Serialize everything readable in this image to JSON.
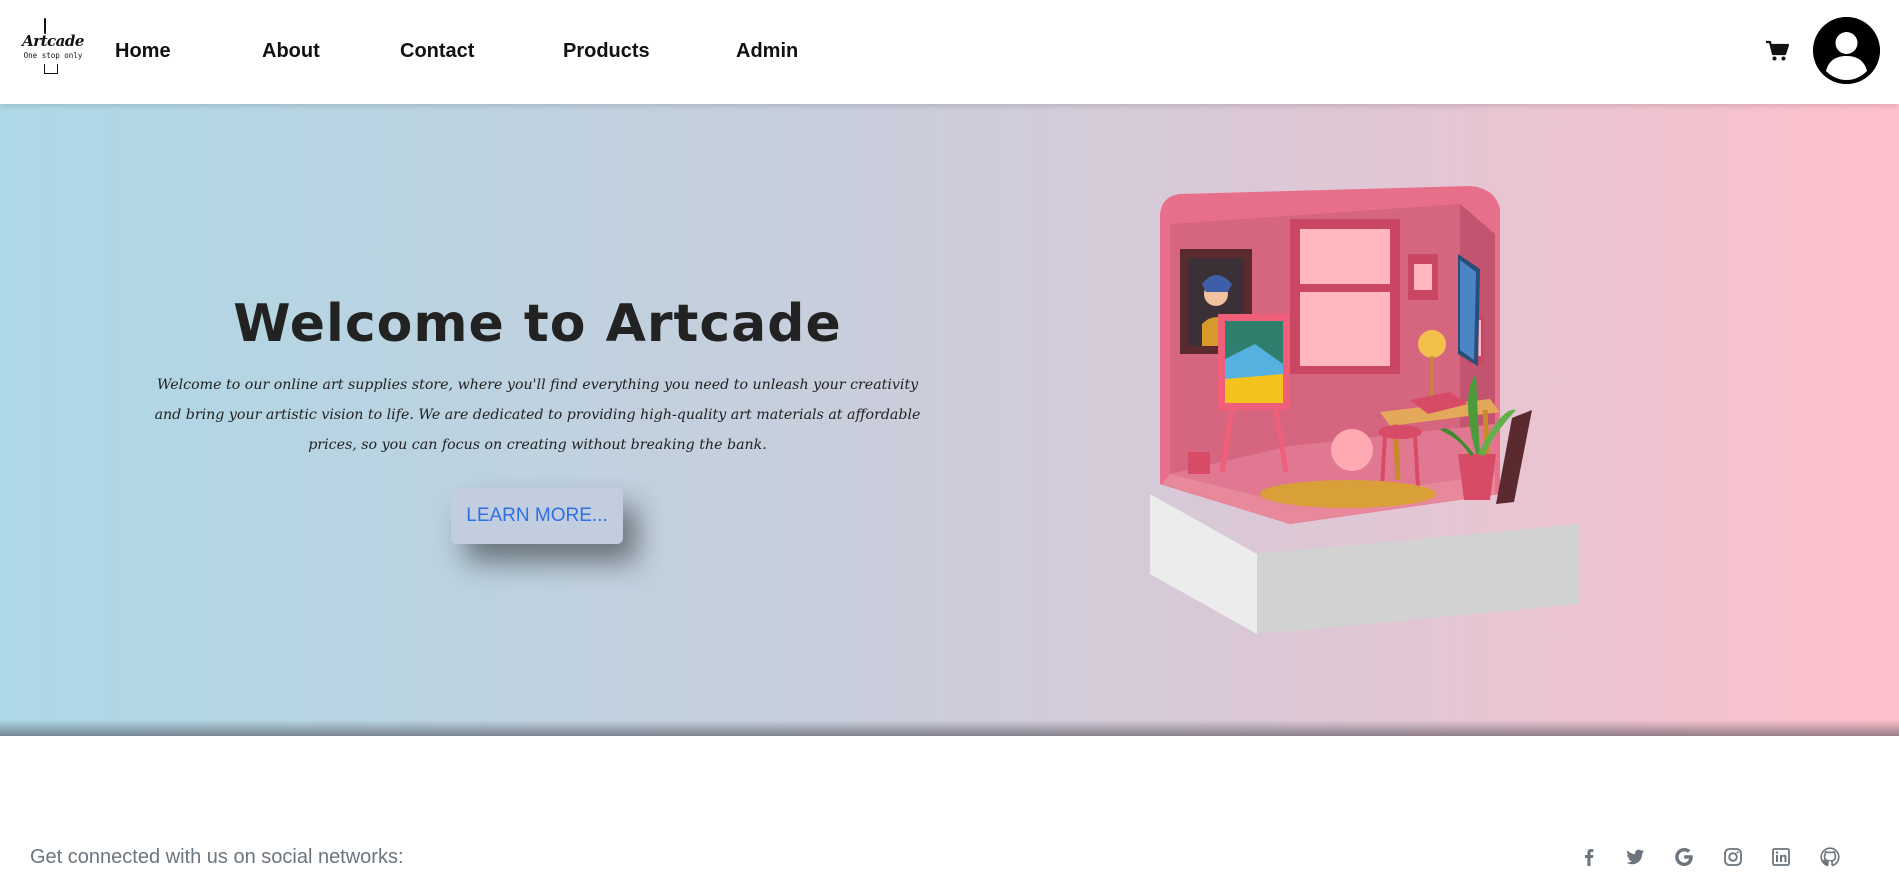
{
  "navbar": {
    "logo": {
      "title": "Artcade",
      "tagline": "One stop only"
    },
    "links": [
      {
        "label": "Home"
      },
      {
        "label": "About"
      },
      {
        "label": "Contact"
      },
      {
        "label": "Products"
      },
      {
        "label": "Admin"
      }
    ],
    "cart_icon": "shopping-cart-icon",
    "avatar_icon": "user-avatar-icon"
  },
  "hero": {
    "title": "Welcome to Artcade",
    "text": "Welcome to our online art supplies store, where you'll find everything you need to unleash your creativity and bring your artistic vision to life. We are dedicated to providing high-quality art materials at affordable prices, so you can focus on creating without breaking the bank.",
    "button_label": "LEARN MORE...",
    "gradient": {
      "left": "#add8e6",
      "right": "#ffc0cb"
    },
    "button_text_color": "#2f6fe6"
  },
  "footer": {
    "text": "Get connected with us on social networks:",
    "social_icons": [
      "facebook-icon",
      "twitter-icon",
      "google-icon",
      "instagram-icon",
      "linkedin-icon",
      "github-icon"
    ]
  }
}
